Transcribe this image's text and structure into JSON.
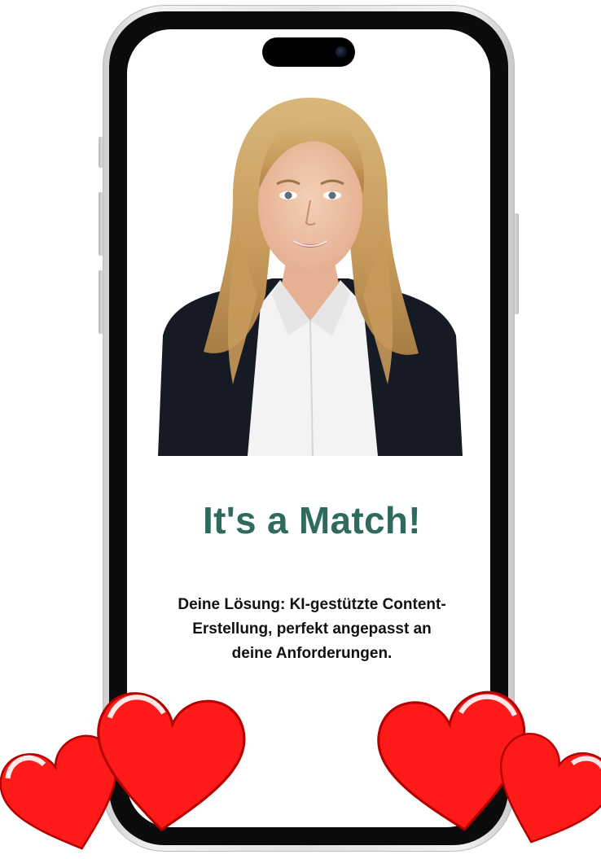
{
  "match_screen": {
    "headline": "It's a Match!",
    "description": "Deine Lösung: KI-gestützte Content-Erstellung, perfekt angepasst an deine Anforderungen."
  },
  "colors": {
    "headline": "#2e6b5e",
    "text": "#111111",
    "heart": "#ff1a1a",
    "heart_outline": "#b30000"
  },
  "icons": [
    "heart-icon"
  ]
}
